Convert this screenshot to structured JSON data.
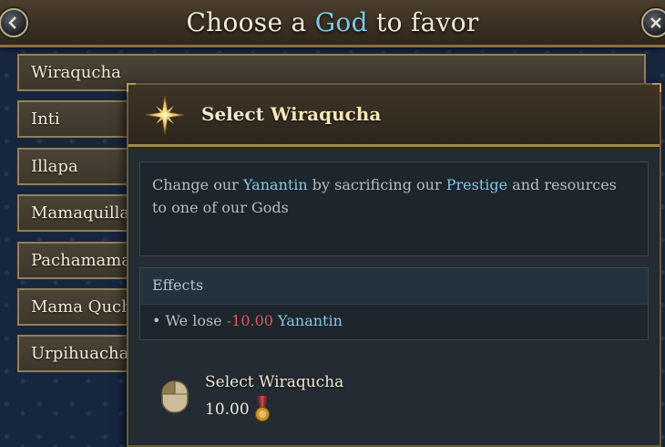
{
  "header": {
    "title_prefix": "Choose a ",
    "title_highlight": "God",
    "title_suffix": " to favor",
    "back_icon": "back-arrow-icon",
    "close_icon": "close-x-icon"
  },
  "gods": [
    {
      "label": "Wiraqucha"
    },
    {
      "label": "Inti"
    },
    {
      "label": "Illapa"
    },
    {
      "label": "Mamaquilla"
    },
    {
      "label": "Pachamama"
    },
    {
      "label": "Mama Quchai"
    },
    {
      "label": "Urpihuachac"
    }
  ],
  "tooltip": {
    "title_prefix": "Select ",
    "title_name": "Wiraqucha",
    "icon": "compass-star-icon",
    "description": {
      "part1": "Change our ",
      "kw1": "Yanantin",
      "part2": " by sacrificing our ",
      "kw2": "Prestige",
      "part3": " and resources to one of our Gods"
    },
    "effects": {
      "heading": "Effects",
      "bullet": "•",
      "text_prefix": " We lose ",
      "value": "-10.00",
      "target": "Yanantin"
    },
    "action": {
      "mouse_icon": "mouse-left-click-icon",
      "label": "Select Wiraqucha",
      "cost": "10.00",
      "cost_icon": "prestige-medal-icon"
    }
  },
  "colors": {
    "highlight": "#7fc7e8",
    "keyword": "#86c6e4",
    "negative": "#e05757",
    "frame_gold": "#a8884e"
  }
}
